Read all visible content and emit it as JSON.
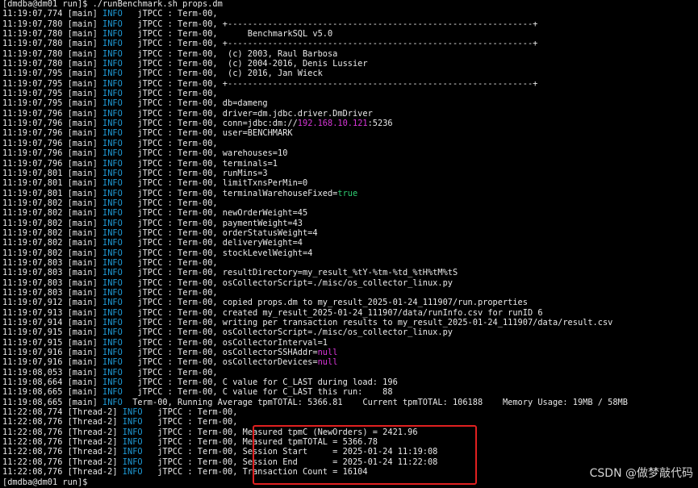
{
  "colors": {
    "background": "#000000",
    "text": "#e8e8e8",
    "info_level": "#1e9bd7",
    "ip_and_null": "#d936d9",
    "boolean_true": "#2ecc71",
    "highlight_border": "#e02020"
  },
  "watermark": "CSDN @做梦敲代码",
  "lines": [
    [
      {
        "t": "[dmdba@dm01 run]$ ./runBenchmark.sh props.dm"
      }
    ],
    [
      {
        "t": "11:19:07,774 [main] "
      },
      {
        "t": "INFO",
        "c": "info"
      },
      {
        "t": "   jTPCC : Term-00, "
      }
    ],
    [
      {
        "t": "11:19:07,780 [main] "
      },
      {
        "t": "INFO",
        "c": "info"
      },
      {
        "t": "   jTPCC : Term-00, +-------------------------------------------------------------+"
      }
    ],
    [
      {
        "t": "11:19:07,780 [main] "
      },
      {
        "t": "INFO",
        "c": "info"
      },
      {
        "t": "   jTPCC : Term-00,      BenchmarkSQL v5.0"
      }
    ],
    [
      {
        "t": "11:19:07,780 [main] "
      },
      {
        "t": "INFO",
        "c": "info"
      },
      {
        "t": "   jTPCC : Term-00, +-------------------------------------------------------------+"
      }
    ],
    [
      {
        "t": "11:19:07,780 [main] "
      },
      {
        "t": "INFO",
        "c": "info"
      },
      {
        "t": "   jTPCC : Term-00,  (c) 2003, Raul Barbosa"
      }
    ],
    [
      {
        "t": "11:19:07,780 [main] "
      },
      {
        "t": "INFO",
        "c": "info"
      },
      {
        "t": "   jTPCC : Term-00,  (c) 2004-2016, Denis Lussier"
      }
    ],
    [
      {
        "t": "11:19:07,795 [main] "
      },
      {
        "t": "INFO",
        "c": "info"
      },
      {
        "t": "   jTPCC : Term-00,  (c) 2016, Jan Wieck"
      }
    ],
    [
      {
        "t": "11:19:07,795 [main] "
      },
      {
        "t": "INFO",
        "c": "info"
      },
      {
        "t": "   jTPCC : Term-00, +-------------------------------------------------------------+"
      }
    ],
    [
      {
        "t": "11:19:07,795 [main] "
      },
      {
        "t": "INFO",
        "c": "info"
      },
      {
        "t": "   jTPCC : Term-00, "
      }
    ],
    [
      {
        "t": "11:19:07,795 [main] "
      },
      {
        "t": "INFO",
        "c": "info"
      },
      {
        "t": "   jTPCC : Term-00, db=dameng"
      }
    ],
    [
      {
        "t": "11:19:07,796 [main] "
      },
      {
        "t": "INFO",
        "c": "info"
      },
      {
        "t": "   jTPCC : Term-00, driver=dm.jdbc.driver.DmDriver"
      }
    ],
    [
      {
        "t": "11:19:07,796 [main] "
      },
      {
        "t": "INFO",
        "c": "info"
      },
      {
        "t": "   jTPCC : Term-00, conn=jdbc:dm://"
      },
      {
        "t": "192.168.10.121",
        "c": "val"
      },
      {
        "t": ":5236"
      }
    ],
    [
      {
        "t": "11:19:07,796 [main] "
      },
      {
        "t": "INFO",
        "c": "info"
      },
      {
        "t": "   jTPCC : Term-00, user=BENCHMARK"
      }
    ],
    [
      {
        "t": "11:19:07,796 [main] "
      },
      {
        "t": "INFO",
        "c": "info"
      },
      {
        "t": "   jTPCC : Term-00, "
      }
    ],
    [
      {
        "t": "11:19:07,796 [main] "
      },
      {
        "t": "INFO",
        "c": "info"
      },
      {
        "t": "   jTPCC : Term-00, warehouses=10"
      }
    ],
    [
      {
        "t": "11:19:07,796 [main] "
      },
      {
        "t": "INFO",
        "c": "info"
      },
      {
        "t": "   jTPCC : Term-00, terminals=1"
      }
    ],
    [
      {
        "t": "11:19:07,801 [main] "
      },
      {
        "t": "INFO",
        "c": "info"
      },
      {
        "t": "   jTPCC : Term-00, runMins=3"
      }
    ],
    [
      {
        "t": "11:19:07,801 [main] "
      },
      {
        "t": "INFO",
        "c": "info"
      },
      {
        "t": "   jTPCC : Term-00, limitTxnsPerMin=0"
      }
    ],
    [
      {
        "t": "11:19:07,801 [main] "
      },
      {
        "t": "INFO",
        "c": "info"
      },
      {
        "t": "   jTPCC : Term-00, terminalWarehouseFixed="
      },
      {
        "t": "true",
        "c": "true"
      }
    ],
    [
      {
        "t": "11:19:07,802 [main] "
      },
      {
        "t": "INFO",
        "c": "info"
      },
      {
        "t": "   jTPCC : Term-00, "
      }
    ],
    [
      {
        "t": "11:19:07,802 [main] "
      },
      {
        "t": "INFO",
        "c": "info"
      },
      {
        "t": "   jTPCC : Term-00, newOrderWeight=45"
      }
    ],
    [
      {
        "t": "11:19:07,802 [main] "
      },
      {
        "t": "INFO",
        "c": "info"
      },
      {
        "t": "   jTPCC : Term-00, paymentWeight=43"
      }
    ],
    [
      {
        "t": "11:19:07,802 [main] "
      },
      {
        "t": "INFO",
        "c": "info"
      },
      {
        "t": "   jTPCC : Term-00, orderStatusWeight=4"
      }
    ],
    [
      {
        "t": "11:19:07,802 [main] "
      },
      {
        "t": "INFO",
        "c": "info"
      },
      {
        "t": "   jTPCC : Term-00, deliveryWeight=4"
      }
    ],
    [
      {
        "t": "11:19:07,802 [main] "
      },
      {
        "t": "INFO",
        "c": "info"
      },
      {
        "t": "   jTPCC : Term-00, stockLevelWeight=4"
      }
    ],
    [
      {
        "t": "11:19:07,803 [main] "
      },
      {
        "t": "INFO",
        "c": "info"
      },
      {
        "t": "   jTPCC : Term-00, "
      }
    ],
    [
      {
        "t": "11:19:07,803 [main] "
      },
      {
        "t": "INFO",
        "c": "info"
      },
      {
        "t": "   jTPCC : Term-00, resultDirectory=my_result_%tY-%tm-%td_%tH%tM%tS"
      }
    ],
    [
      {
        "t": "11:19:07,803 [main] "
      },
      {
        "t": "INFO",
        "c": "info"
      },
      {
        "t": "   jTPCC : Term-00, osCollectorScript=./misc/os_collector_linux.py"
      }
    ],
    [
      {
        "t": "11:19:07,803 [main] "
      },
      {
        "t": "INFO",
        "c": "info"
      },
      {
        "t": "   jTPCC : Term-00, "
      }
    ],
    [
      {
        "t": "11:19:07,912 [main] "
      },
      {
        "t": "INFO",
        "c": "info"
      },
      {
        "t": "   jTPCC : Term-00, copied props.dm to my_result_2025-01-24_111907/run.properties"
      }
    ],
    [
      {
        "t": "11:19:07,913 [main] "
      },
      {
        "t": "INFO",
        "c": "info"
      },
      {
        "t": "   jTPCC : Term-00, created my_result_2025-01-24_111907/data/runInfo.csv for runID 6"
      }
    ],
    [
      {
        "t": "11:19:07,914 [main] "
      },
      {
        "t": "INFO",
        "c": "info"
      },
      {
        "t": "   jTPCC : Term-00, writing per transaction results to my_result_2025-01-24_111907/data/result.csv"
      }
    ],
    [
      {
        "t": "11:19:07,915 [main] "
      },
      {
        "t": "INFO",
        "c": "info"
      },
      {
        "t": "   jTPCC : Term-00, osCollectorScript=./misc/os_collector_linux.py"
      }
    ],
    [
      {
        "t": "11:19:07,915 [main] "
      },
      {
        "t": "INFO",
        "c": "info"
      },
      {
        "t": "   jTPCC : Term-00, osCollectorInterval=1"
      }
    ],
    [
      {
        "t": "11:19:07,916 [main] "
      },
      {
        "t": "INFO",
        "c": "info"
      },
      {
        "t": "   jTPCC : Term-00, osCollectorSSHAddr="
      },
      {
        "t": "null",
        "c": "val"
      }
    ],
    [
      {
        "t": "11:19:07,916 [main] "
      },
      {
        "t": "INFO",
        "c": "info"
      },
      {
        "t": "   jTPCC : Term-00, osCollectorDevices="
      },
      {
        "t": "null",
        "c": "val"
      }
    ],
    [
      {
        "t": "11:19:08,053 [main] "
      },
      {
        "t": "INFO",
        "c": "info"
      },
      {
        "t": "   jTPCC : Term-00, "
      }
    ],
    [
      {
        "t": "11:19:08,664 [main] "
      },
      {
        "t": "INFO",
        "c": "info"
      },
      {
        "t": "   jTPCC : Term-00, C value for C_LAST during load: 196"
      }
    ],
    [
      {
        "t": "11:19:08,665 [main] "
      },
      {
        "t": "INFO",
        "c": "info"
      },
      {
        "t": "   jTPCC : Term-00, C value for C_LAST this run:    88"
      }
    ],
    [
      {
        "t": "11:19:08,665 [main] "
      },
      {
        "t": "INFO",
        "c": "info"
      },
      {
        "t": "  Term-00, Running Average tpmTOTAL: 5366.81    Current tpmTOTAL: 106188    Memory Usage: 19MB / 58MB"
      }
    ],
    [
      {
        "t": "11:22:08,774 [Thread-2] "
      },
      {
        "t": "INFO",
        "c": "info"
      },
      {
        "t": "   jTPCC : Term-00, "
      }
    ],
    [
      {
        "t": "11:22:08,776 [Thread-2] "
      },
      {
        "t": "INFO",
        "c": "info"
      },
      {
        "t": "   jTPCC : Term-00, "
      }
    ],
    [
      {
        "t": "11:22:08,776 [Thread-2] "
      },
      {
        "t": "INFO",
        "c": "info"
      },
      {
        "t": "   jTPCC : Term-00, Measured tpmC (NewOrders) = 2421.96"
      }
    ],
    [
      {
        "t": "11:22:08,776 [Thread-2] "
      },
      {
        "t": "INFO",
        "c": "info"
      },
      {
        "t": "   jTPCC : Term-00, Measured tpmTOTAL = 5366.78"
      }
    ],
    [
      {
        "t": "11:22:08,776 [Thread-2] "
      },
      {
        "t": "INFO",
        "c": "info"
      },
      {
        "t": "   jTPCC : Term-00, Session Start     = 2025-01-24 11:19:08"
      }
    ],
    [
      {
        "t": "11:22:08,776 [Thread-2] "
      },
      {
        "t": "INFO",
        "c": "info"
      },
      {
        "t": "   jTPCC : Term-00, Session End       = 2025-01-24 11:22:08"
      }
    ],
    [
      {
        "t": "11:22:08,776 [Thread-2] "
      },
      {
        "t": "INFO",
        "c": "info"
      },
      {
        "t": "   jTPCC : Term-00, Transaction Count = 16104"
      }
    ],
    [
      {
        "t": "[dmdba@dm01 run]$ "
      }
    ]
  ]
}
